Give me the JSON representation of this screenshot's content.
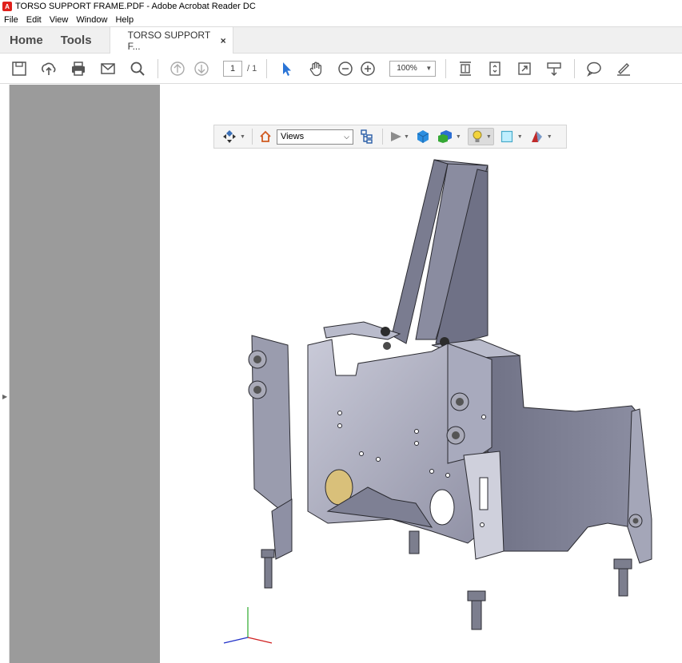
{
  "window": {
    "title": "TORSO SUPPORT FRAME.PDF - Adobe Acrobat Reader DC"
  },
  "menu": [
    "File",
    "Edit",
    "View",
    "Window",
    "Help"
  ],
  "tabs": {
    "home": "Home",
    "tools": "Tools",
    "document": "TORSO SUPPORT F...",
    "close": "×"
  },
  "toolbar": {
    "page_current": "1",
    "page_total": "/ 1",
    "zoom": "100%"
  },
  "toolbar_3d": {
    "views_label": "Views"
  },
  "icons": [
    "save-icon",
    "upload-icon",
    "print-icon",
    "email-icon",
    "search-icon",
    "page-up-icon",
    "page-down-icon",
    "select-arrow-icon",
    "hand-icon",
    "zoom-out-icon",
    "zoom-in-icon",
    "fit-page-icon",
    "scroll-mode-icon",
    "fullscreen-icon",
    "read-mode-icon",
    "comment-icon",
    "sign-icon"
  ],
  "colors": {
    "accent_red": "#e0201b",
    "panel_grey": "#9b9b9b",
    "select_blue": "#2a74d6"
  }
}
